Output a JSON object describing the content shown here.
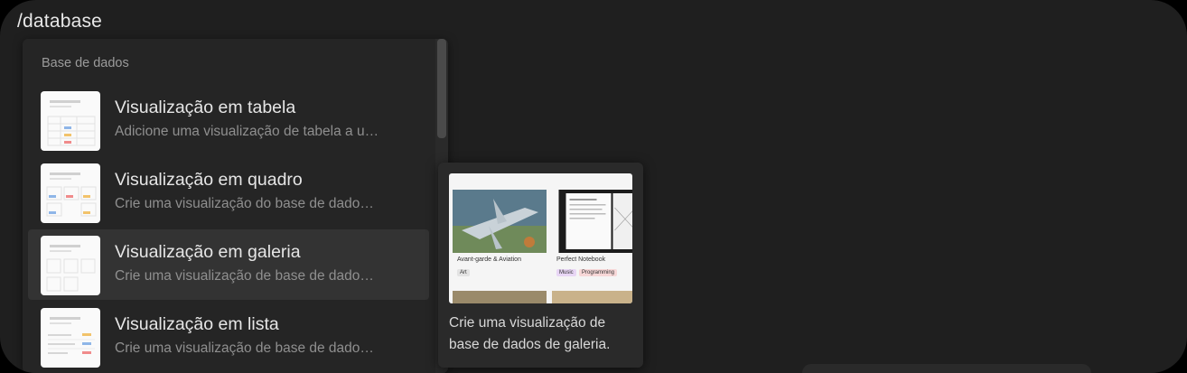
{
  "command": "/database",
  "menu": {
    "section_label": "Base de dados",
    "items": [
      {
        "title": "Visualização em tabela",
        "description": "Adicione uma visualização de tabela a u…",
        "icon": "table-view-thumbnail",
        "active": false
      },
      {
        "title": "Visualização em quadro",
        "description": "Crie uma visualização do base de dado…",
        "icon": "board-view-thumbnail",
        "active": false
      },
      {
        "title": "Visualização em galeria",
        "description": "Crie uma visualização de base de dado…",
        "icon": "gallery-view-thumbnail",
        "active": true
      },
      {
        "title": "Visualização em lista",
        "description": "Crie uma visualização de base de dado…",
        "icon": "list-view-thumbnail",
        "active": false
      }
    ]
  },
  "preview": {
    "description": "Crie uma visualização de base de dados de galeria.",
    "cards": [
      {
        "caption": "Avant-garde & Aviation",
        "tags": [
          "Art"
        ]
      },
      {
        "caption": "Perfect Notebook",
        "tags": [
          "Music",
          "Programming"
        ]
      }
    ]
  },
  "colors": {
    "background": "#1f1f1f",
    "menu": "#252525",
    "active_item": "#333333",
    "tooltip": "#2a2a2a"
  }
}
